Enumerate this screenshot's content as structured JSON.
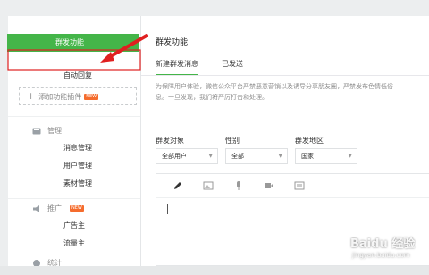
{
  "sidebar": {
    "function_section": "功能",
    "active_item": "群发功能",
    "auto_reply": "自动回复",
    "add_plugin": "添加功能插件",
    "new_badge": "NEW",
    "manage_section": "管理",
    "manage_items": [
      "消息管理",
      "用户管理",
      "素材管理"
    ],
    "promote_section": "推广",
    "promote_items": [
      "广告主",
      "流量主"
    ],
    "bottom_section": "统计"
  },
  "main": {
    "title": "群发功能",
    "tabs": [
      "新建群发消息",
      "已发送"
    ],
    "notice_lines": [
      "为保障用户体验，微信公众平台严禁恶意营销以及诱导分享朋友圈，严禁发布色情低俗",
      "息。一旦发现，我们将严厉打击和处理。"
    ],
    "filters": [
      {
        "label": "群发对象",
        "value": "全部用户"
      },
      {
        "label": "性别",
        "value": "全部"
      },
      {
        "label": "群发地区",
        "value": "国家"
      }
    ]
  },
  "editor": {
    "tools": [
      "pencil-icon",
      "image-icon",
      "audio-icon",
      "video-icon",
      "news-icon"
    ]
  },
  "watermark": {
    "main": "Baidu 经验",
    "sub": "jingyan.baidu.com"
  },
  "colors": {
    "accent": "#44b549",
    "arrow": "#e02020",
    "badge": "#f56c2d"
  }
}
